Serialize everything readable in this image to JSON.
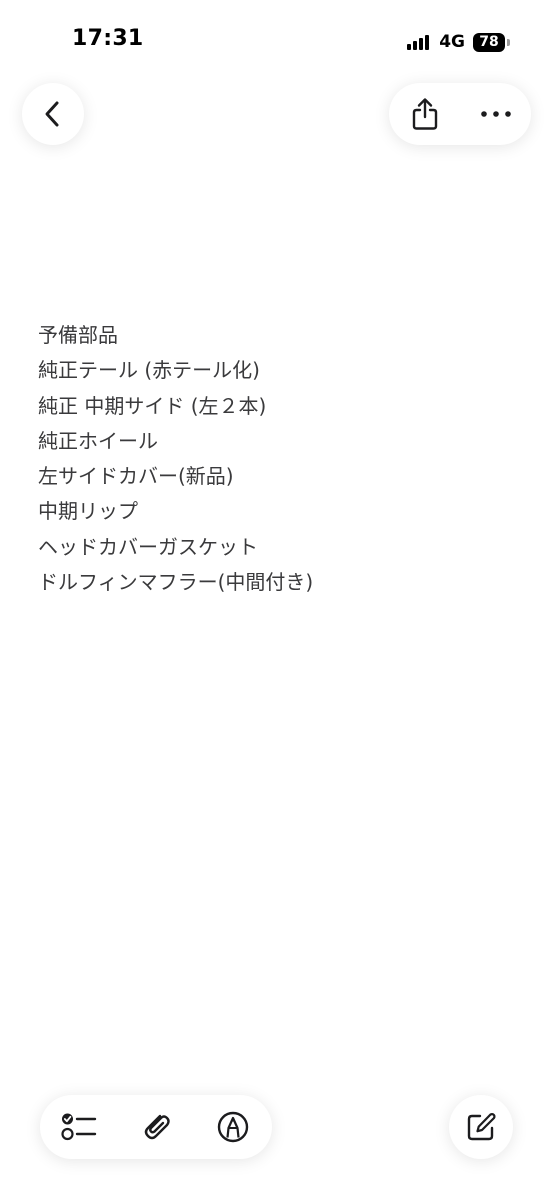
{
  "status_bar": {
    "time": "17:31",
    "network": "4G",
    "battery": "78"
  },
  "icons": {
    "back": "chevron-left-icon",
    "share": "share-icon",
    "more": "ellipsis-icon",
    "checklist": "checklist-icon",
    "attach": "paperclip-icon",
    "markup": "markup-pen-icon",
    "compose": "compose-icon"
  },
  "note": {
    "lines": [
      "予備部品",
      "純正テール (赤テール化)",
      "純正 中期サイド (左２本)",
      "純正ホイール",
      "左サイドカバー(新品)",
      "中期リップ",
      "ヘッドカバーガスケット",
      "ドルフィンマフラー(中間付き)"
    ]
  },
  "colors": {
    "text": "#3a3a3c",
    "icon": "#1c1c1e",
    "background": "#ffffff"
  }
}
